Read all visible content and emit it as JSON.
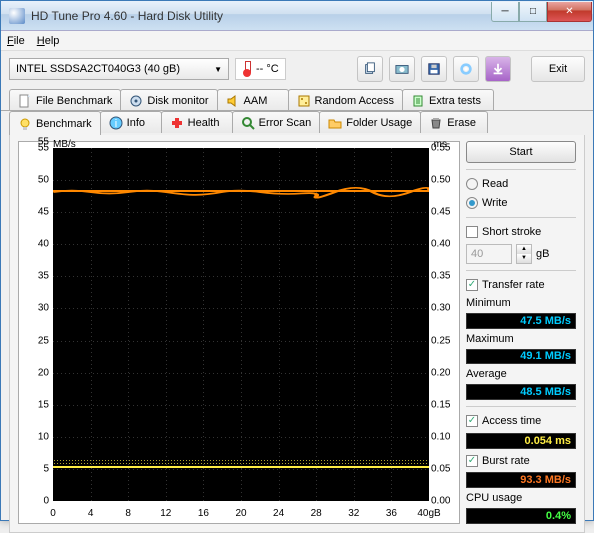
{
  "window": {
    "title": "HD Tune Pro 4.60 - Hard Disk Utility"
  },
  "menu": {
    "file": "File",
    "help": "Help"
  },
  "toolbar": {
    "drive": "INTEL SSDSA2CT040G3    (40 gB)",
    "temp": "-- °C",
    "exit": "Exit"
  },
  "tabs_top": [
    "File Benchmark",
    "Disk monitor",
    "AAM",
    "Random Access",
    "Extra tests"
  ],
  "tabs_bottom": [
    "Benchmark",
    "Info",
    "Health",
    "Error Scan",
    "Folder Usage",
    "Erase"
  ],
  "sidebar": {
    "start": "Start",
    "read": "Read",
    "write": "Write",
    "short_stroke": "Short stroke",
    "ss_val": "40",
    "ss_unit": "gB",
    "transfer_rate": "Transfer rate",
    "minimum": "Minimum",
    "min_val": "47.5 MB/s",
    "maximum": "Maximum",
    "max_val": "49.1 MB/s",
    "average": "Average",
    "avg_val": "48.5 MB/s",
    "access_time": "Access time",
    "access_val": "0.054 ms",
    "burst_rate": "Burst rate",
    "burst_val": "93.3 MB/s",
    "cpu_usage": "CPU usage",
    "cpu_val": "0.4%"
  },
  "chart_data": {
    "type": "line",
    "title": "",
    "x_unit": "gB",
    "y_left_unit": "MB/s",
    "y_right_unit": "ms",
    "x_range": [
      0,
      40
    ],
    "x_ticks": [
      0,
      4,
      8,
      12,
      16,
      20,
      24,
      28,
      32,
      36,
      40
    ],
    "y_left_range": [
      0,
      55
    ],
    "y_left_ticks": [
      0,
      5,
      10,
      15,
      20,
      25,
      30,
      35,
      40,
      45,
      50,
      55
    ],
    "y_right_range": [
      0,
      0.55
    ],
    "y_right_ticks": [
      0.0,
      0.05,
      0.1,
      0.15,
      0.2,
      0.25,
      0.3,
      0.35,
      0.4,
      0.45,
      0.5,
      0.55
    ],
    "series": [
      {
        "name": "Transfer rate (MB/s)",
        "axis": "left",
        "color": "#ff8800",
        "x": [
          0,
          4,
          8,
          12,
          16,
          20,
          24,
          28,
          32,
          36,
          40
        ],
        "y": [
          48.5,
          48.5,
          48.5,
          48.5,
          48.5,
          48.5,
          48.5,
          48.5,
          48.5,
          48.5,
          48.5
        ],
        "min": 47.5,
        "max": 49.1,
        "avg": 48.5
      },
      {
        "name": "Access time (ms)",
        "axis": "right",
        "color": "#ffee44",
        "x": [
          0,
          4,
          8,
          12,
          16,
          20,
          24,
          28,
          32,
          36,
          40
        ],
        "y": [
          0.054,
          0.054,
          0.054,
          0.054,
          0.054,
          0.054,
          0.054,
          0.054,
          0.054,
          0.054,
          0.054
        ],
        "avg": 0.054
      }
    ]
  },
  "xlabel_last": "40gB"
}
